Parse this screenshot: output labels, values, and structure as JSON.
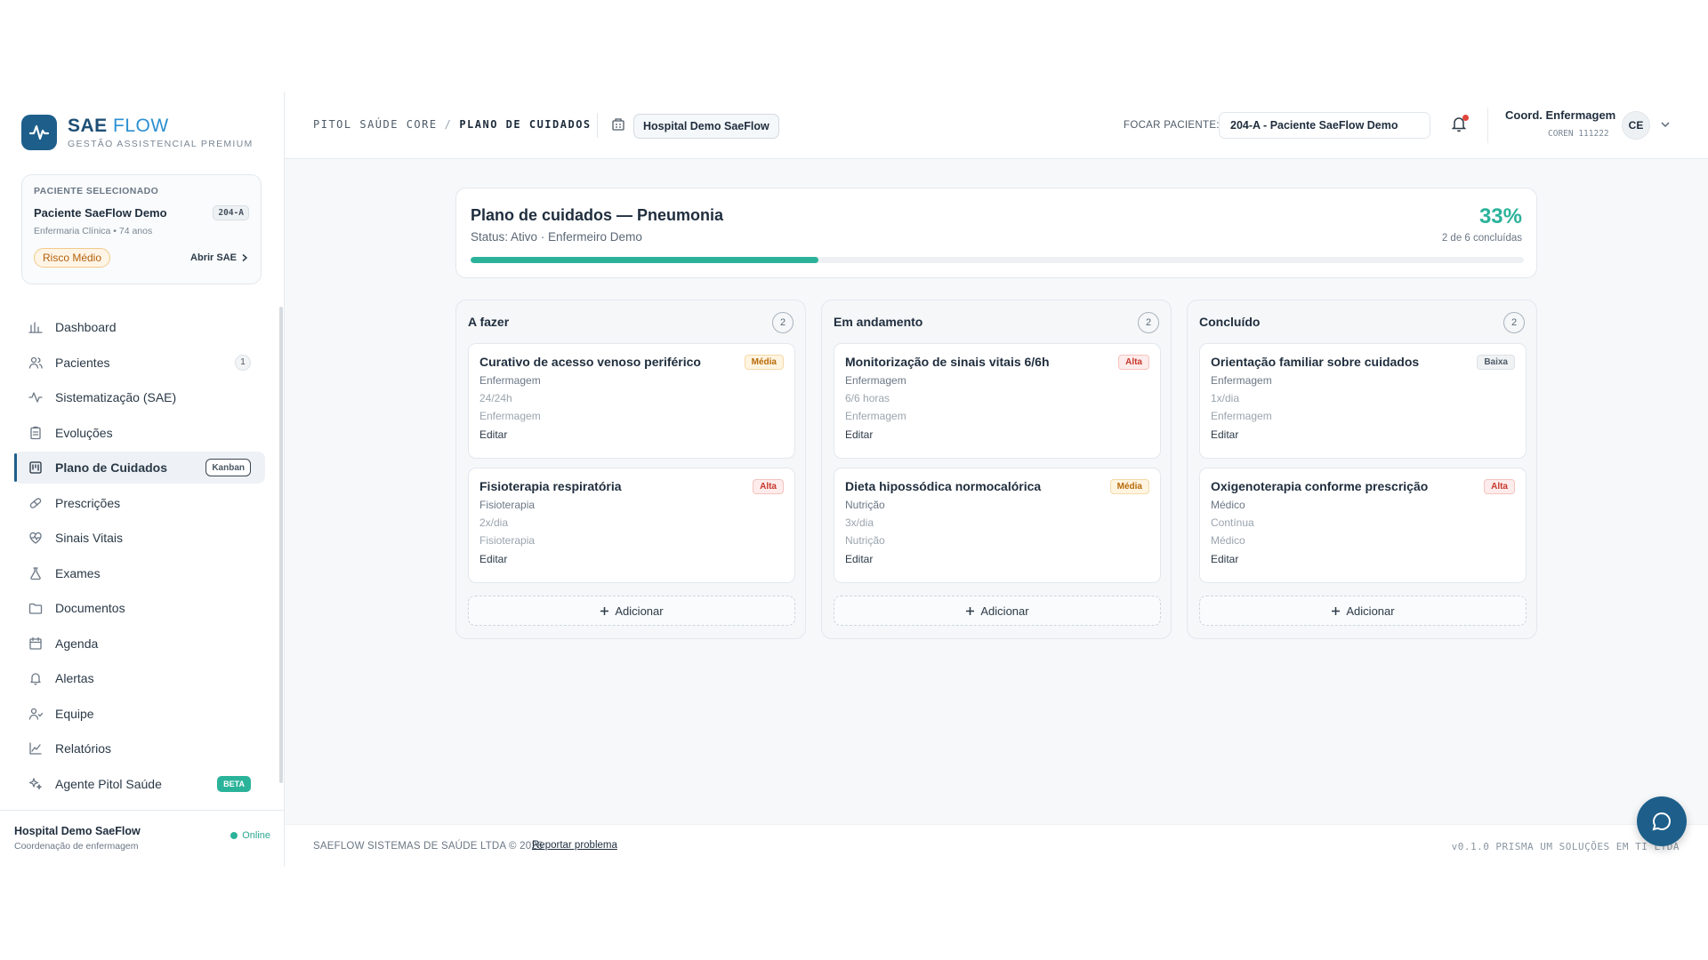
{
  "brand": {
    "name_bold": "SAE",
    "name_light": "FLOW",
    "subtitle": "GESTÃO ASSISTENCIAL PREMIUM"
  },
  "patient_card": {
    "label": "PACIENTE SELECIONADO",
    "name": "Paciente SaeFlow Demo",
    "bed": "204-A",
    "meta": "Enfermaria Clínica • 74 anos",
    "risk": "Risco Médio",
    "open_sae": "Abrir SAE"
  },
  "nav": [
    {
      "label": "Dashboard",
      "icon": "chart-bar-icon"
    },
    {
      "label": "Pacientes",
      "icon": "users-icon",
      "badge": "1"
    },
    {
      "label": "Sistematização (SAE)",
      "icon": "activity-icon"
    },
    {
      "label": "Evoluções",
      "icon": "clipboard-icon"
    },
    {
      "label": "Plano de Cuidados",
      "icon": "kanban-icon",
      "badge": "Kanban",
      "active": true
    },
    {
      "label": "Prescrições",
      "icon": "pill-icon"
    },
    {
      "label": "Sinais Vitais",
      "icon": "heart-pulse-icon"
    },
    {
      "label": "Exames",
      "icon": "flask-icon"
    },
    {
      "label": "Documentos",
      "icon": "folder-icon"
    },
    {
      "label": "Agenda",
      "icon": "calendar-icon"
    },
    {
      "label": "Alertas",
      "icon": "bell-icon"
    },
    {
      "label": "Equipe",
      "icon": "team-icon"
    },
    {
      "label": "Relatórios",
      "icon": "line-chart-icon"
    },
    {
      "label": "Agente Pitol Saúde",
      "icon": "sparkles-icon",
      "badge": "BETA"
    }
  ],
  "sidebar_footer": {
    "title": "Hospital Demo SaeFlow",
    "subtitle": "Coordenação de enfermagem",
    "status": "Online"
  },
  "header": {
    "breadcrumb_root": "PITOL SAÚDE CORE",
    "breadcrumb_sep": "/",
    "breadcrumb_current": "PLANO DE CUIDADOS",
    "hospital": "Hospital Demo SaeFlow",
    "focus_label": "FOCAR PACIENTE:",
    "focus_value": "204-A - Paciente SaeFlow Demo",
    "user_name": "Coord. Enfermagem",
    "user_sub": "COREN 111222",
    "avatar": "CE"
  },
  "summary": {
    "title": "Plano de cuidados — Pneumonia",
    "status": "Status: Ativo · Enfermeiro Demo",
    "percent": "33%",
    "done_text": "2 de 6 concluídas",
    "progress": 0.33
  },
  "columns": [
    {
      "title": "A fazer",
      "count": "2",
      "add_label": "Adicionar",
      "cards": [
        {
          "title": "Curativo de acesso venoso periférico",
          "priority": "Média",
          "prio_class": "media",
          "discipline": "Enfermagem",
          "frequency": "24/24h",
          "responsible": "Enfermagem",
          "edit": "Editar"
        },
        {
          "title": "Fisioterapia respiratória",
          "priority": "Alta",
          "prio_class": "alta",
          "discipline": "Fisioterapia",
          "frequency": "2x/dia",
          "responsible": "Fisioterapia",
          "edit": "Editar"
        }
      ]
    },
    {
      "title": "Em andamento",
      "count": "2",
      "add_label": "Adicionar",
      "cards": [
        {
          "title": "Monitorização de sinais vitais 6/6h",
          "priority": "Alta",
          "prio_class": "alta",
          "discipline": "Enfermagem",
          "frequency": "6/6 horas",
          "responsible": "Enfermagem",
          "edit": "Editar"
        },
        {
          "title": "Dieta hipossódica normocalórica",
          "priority": "Média",
          "prio_class": "media",
          "discipline": "Nutrição",
          "frequency": "3x/dia",
          "responsible": "Nutrição",
          "edit": "Editar"
        }
      ]
    },
    {
      "title": "Concluído",
      "count": "2",
      "add_label": "Adicionar",
      "cards": [
        {
          "title": "Orientação familiar sobre cuidados",
          "priority": "Baixa",
          "prio_class": "baixa",
          "discipline": "Enfermagem",
          "frequency": "1x/dia",
          "responsible": "Enfermagem",
          "edit": "Editar"
        },
        {
          "title": "Oxigenoterapia conforme prescrição",
          "priority": "Alta",
          "prio_class": "alta",
          "discipline": "Médico",
          "frequency": "Contínua",
          "responsible": "Médico",
          "edit": "Editar"
        }
      ]
    }
  ],
  "footer": {
    "copyright": "SAEFLOW SISTEMAS DE SAÚDE LTDA © 2026",
    "report_link": "Reportar problema",
    "right_text": "v0.1.0  PRISMA UM SOLUÇÕES EM TI LTDA"
  },
  "colors": {
    "brand": "#1d5f8a",
    "accent": "#2bb39a",
    "alert": "#e0443a"
  }
}
